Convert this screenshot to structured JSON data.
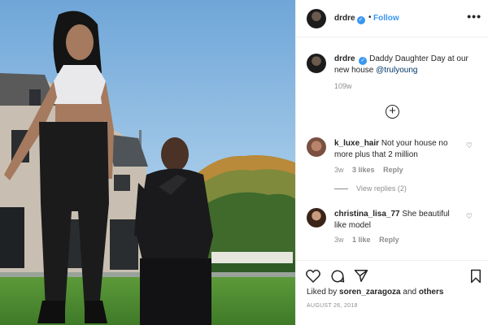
{
  "post": {
    "username": "drdre",
    "verified_icon": "verified-badge-icon",
    "separator": "•",
    "follow_label": "Follow",
    "more_label": "•••"
  },
  "caption": {
    "username": "drdre",
    "text": "Daddy Daughter Day at our new house",
    "mention": "@trulyoung",
    "time": "109w"
  },
  "load_more_label": "+",
  "comments": [
    {
      "username": "k_luxe_hair",
      "text": "Not your house no more plus that 2 million",
      "time": "3w",
      "likes": "3 likes",
      "reply": "Reply",
      "view_replies": "View replies (2)"
    },
    {
      "username": "christina_lisa_77",
      "text": "She beautiful like model",
      "time": "3w",
      "likes": "1 like",
      "reply": "Reply"
    }
  ],
  "footer": {
    "liked_prefix": "Liked by",
    "liked_user": "soren_zaragoza",
    "liked_and": "and",
    "liked_others": "others",
    "date": "AUGUST 26, 2018"
  },
  "colors": {
    "accent": "#3897f0",
    "text": "#262626",
    "muted": "#8e8e8e"
  }
}
